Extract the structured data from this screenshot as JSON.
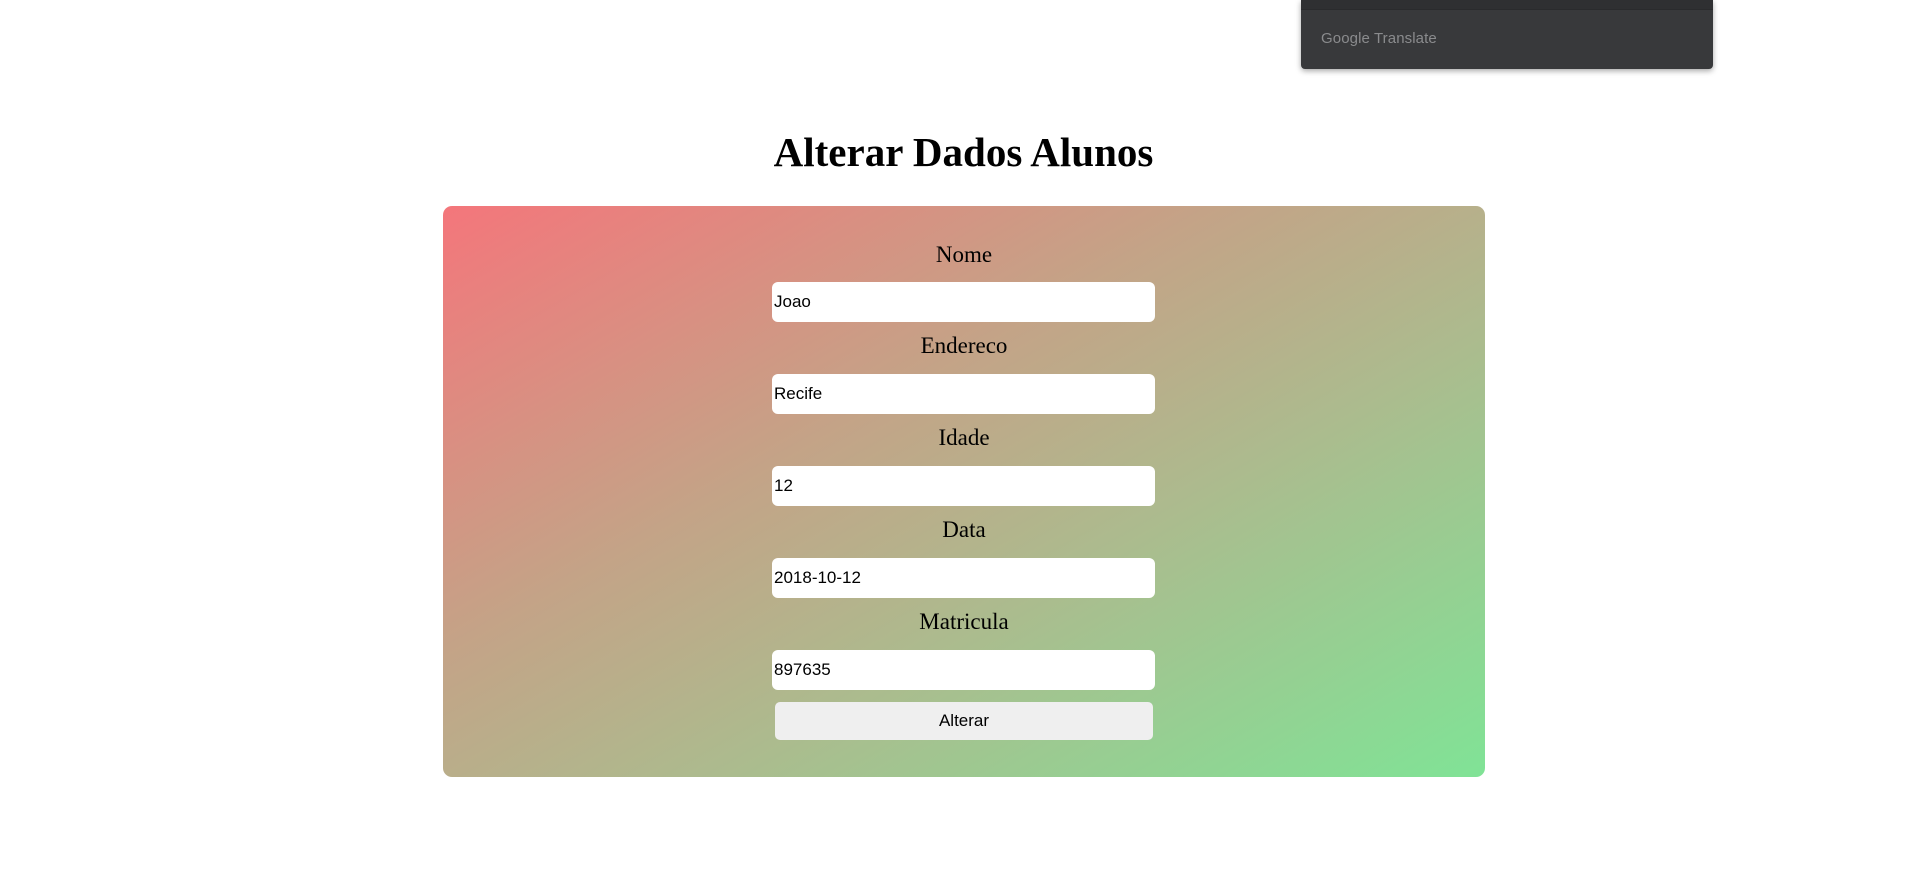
{
  "translate_popup": {
    "brand": "Google Translate"
  },
  "page": {
    "title": "Alterar Dados Alunos"
  },
  "form": {
    "fields": [
      {
        "label": "Nome",
        "value": "Joao"
      },
      {
        "label": "Endereco",
        "value": "Recife"
      },
      {
        "label": "Idade",
        "value": "12"
      },
      {
        "label": "Data",
        "value": "2018-10-12"
      },
      {
        "label": "Matricula",
        "value": "897635"
      }
    ],
    "submit_label": "Alterar"
  },
  "colors": {
    "gradient_start": "#f4767b",
    "gradient_end": "#80e396",
    "popup_background": "#38393b"
  }
}
